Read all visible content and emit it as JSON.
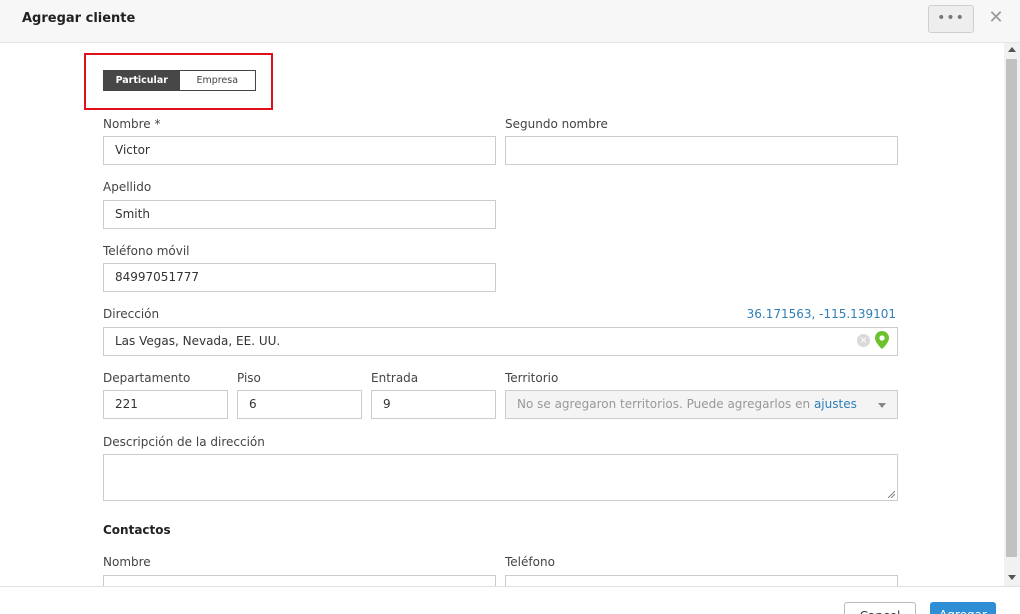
{
  "header": {
    "title": "Agregar cliente",
    "more_label": "•••",
    "close_label": "✕"
  },
  "client_type": {
    "options": [
      "Particular",
      "Empresa"
    ],
    "selected": "Particular"
  },
  "form": {
    "first_name": {
      "label": "Nombre *",
      "value": "Victor"
    },
    "middle_name": {
      "label": "Segundo nombre",
      "value": ""
    },
    "last_name": {
      "label": "Apellido",
      "value": "Smith"
    },
    "mobile_phone": {
      "label": "Teléfono móvil",
      "value": "84997051777"
    },
    "address": {
      "label": "Dirección",
      "coordinates": "36.171563, -115.139101",
      "value": "Las Vegas, Nevada, EE. UU."
    },
    "apartment": {
      "label": "Departamento",
      "value": "221"
    },
    "floor": {
      "label": "Piso",
      "value": "6"
    },
    "entrance": {
      "label": "Entrada",
      "value": "9"
    },
    "territory": {
      "label": "Territorio",
      "placeholder_text": "No se agregaron territorios. Puede agregarlos en ",
      "placeholder_link": "ajustes"
    },
    "address_description": {
      "label": "Descripción de la dirección",
      "value": ""
    }
  },
  "contacts": {
    "title": "Contactos",
    "name_label": "Nombre",
    "phone_label": "Teléfono"
  },
  "footer": {
    "cancel_label": "Cancel",
    "add_label": "Agregar"
  },
  "colors": {
    "accent": "#2f8fd6",
    "link": "#2f7fb6",
    "highlight": "#e0101a",
    "pin": "#6cc22e"
  }
}
